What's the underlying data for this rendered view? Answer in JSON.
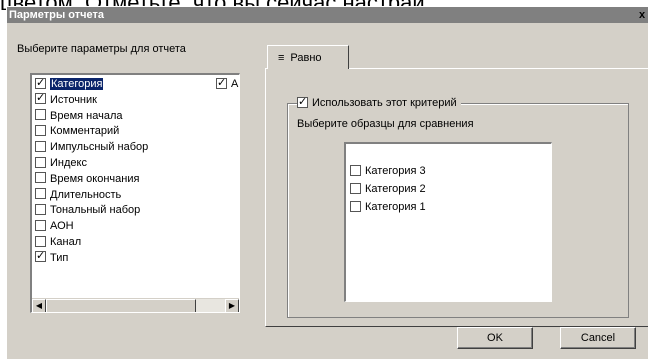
{
  "background_text": "цветом. Отметьте, что вы сейчас настрай",
  "dialog": {
    "title": "Парметры отчета",
    "close_label": "x",
    "section_label": "Выберите параметры для отчета",
    "params": [
      {
        "label": "Категория",
        "checked": true,
        "selected": true
      },
      {
        "label": "Источник",
        "checked": true,
        "selected": false
      },
      {
        "label": "Время начала",
        "checked": false,
        "selected": false
      },
      {
        "label": "Комментарий",
        "checked": false,
        "selected": false
      },
      {
        "label": "Импульсный набор",
        "checked": false,
        "selected": false
      },
      {
        "label": "Индекс",
        "checked": false,
        "selected": false
      },
      {
        "label": "Время окончания",
        "checked": false,
        "selected": false
      },
      {
        "label": "Длительность",
        "checked": false,
        "selected": false
      },
      {
        "label": "Тональный набор",
        "checked": false,
        "selected": false
      },
      {
        "label": "АОН",
        "checked": false,
        "selected": false
      },
      {
        "label": "Канал",
        "checked": false,
        "selected": false
      },
      {
        "label": "Тип",
        "checked": true,
        "selected": false
      }
    ],
    "col2_item": {
      "label": "А",
      "checked": true
    },
    "tab": {
      "icon": "equals-icon",
      "label": "Равно"
    },
    "criterion": {
      "label": "Использовать этот критерий",
      "checked": true
    },
    "samples_label": "Выберите образцы для сравнения",
    "samples": [
      {
        "label": "Категория 3",
        "checked": false
      },
      {
        "label": "Категория 2",
        "checked": false
      },
      {
        "label": "Категория 1",
        "checked": false
      }
    ],
    "ok_label": "OK",
    "cancel_label": "Cancel"
  }
}
